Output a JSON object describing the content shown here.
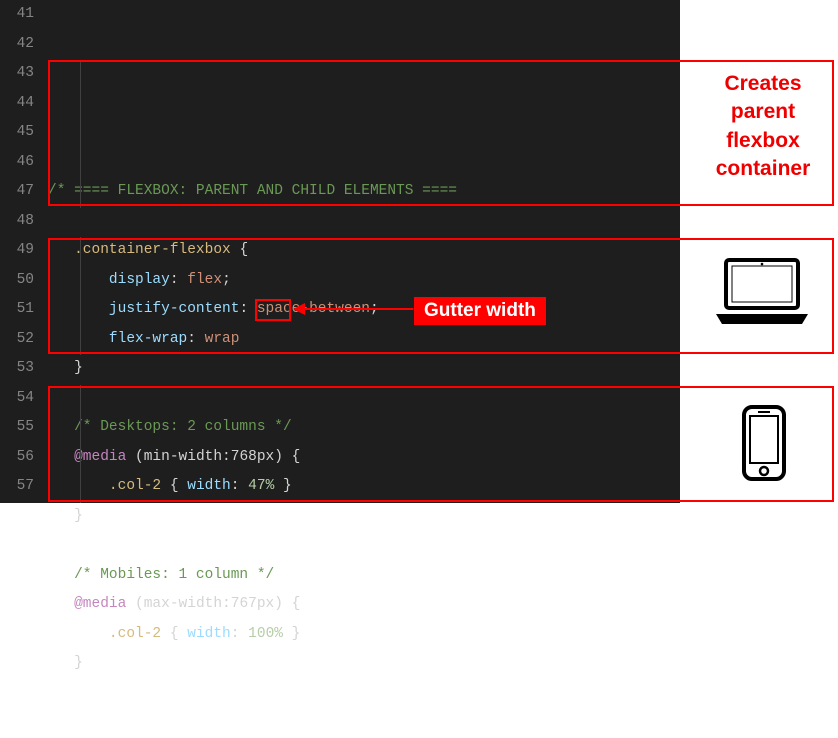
{
  "line_numbers": [
    "41",
    "42",
    "43",
    "44",
    "45",
    "46",
    "47",
    "48",
    "49",
    "50",
    "51",
    "52",
    "53",
    "54",
    "55",
    "56",
    "57"
  ],
  "code": {
    "c41": "/* ==== FLEXBOX: PARENT AND CHILD ELEMENTS ====",
    "sel_container": ".container-flexbox",
    "brace_open": " {",
    "brace_close": "}",
    "prop_display": "display",
    "val_display": "flex",
    "prop_justify": "justify-content",
    "val_justify": "space-between",
    "prop_flexwrap": "flex-wrap",
    "val_flexwrap": "wrap",
    "semi": ";",
    "colon": ": ",
    "c49": "/* Desktops: 2 columns */",
    "at_media": "@media",
    "media_q_desktop": "(min-width:768px)",
    "sel_col2": ".col-2",
    "prop_width": "width",
    "val_width_desktop": "47%",
    "val_width_mobile": "100%",
    "c54": "/* Mobiles: 1 column */",
    "media_q_mobile": "(max-width:767px)"
  },
  "annotations": {
    "creates1": "Creates",
    "creates2": "parent",
    "creates3": "flexbox",
    "creates4": "container",
    "gutter_label": "Gutter width"
  },
  "icons": {
    "laptop": "laptop-icon",
    "phone": "phone-icon"
  }
}
